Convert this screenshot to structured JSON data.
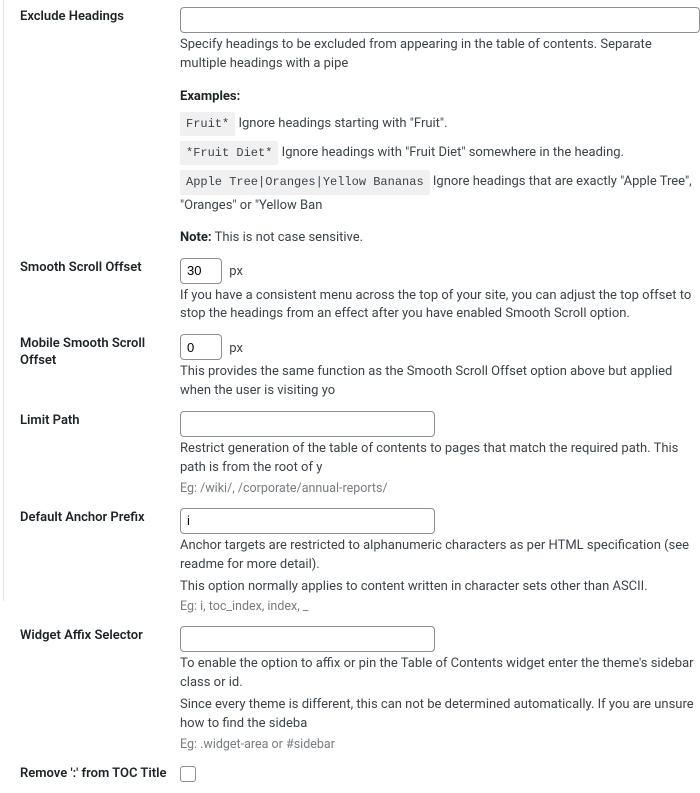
{
  "exclude": {
    "label": "Exclude Headings",
    "value": "",
    "desc": "Specify headings to be excluded from appearing in the table of contents. Separate multiple headings with a pipe",
    "examples_label": "Examples:",
    "examples": [
      {
        "code": "Fruit*",
        "text": "Ignore headings starting with \"Fruit\"."
      },
      {
        "code": "*Fruit Diet*",
        "text": "Ignore headings with \"Fruit Diet\" somewhere in the heading."
      },
      {
        "code": "Apple Tree|Oranges|Yellow Bananas",
        "text": "Ignore headings that are exactly \"Apple Tree\", \"Oranges\" or \"Yellow Ban"
      }
    ],
    "note_label": "Note:",
    "note_text": "This is not case sensitive."
  },
  "scroll": {
    "label": "Smooth Scroll Offset",
    "value": "30",
    "unit": "px",
    "desc": "If you have a consistent menu across the top of your site, you can adjust the top offset to stop the headings from an effect after you have enabled Smooth Scroll option."
  },
  "mscroll": {
    "label": "Mobile Smooth Scroll Offset",
    "value": "0",
    "unit": "px",
    "desc": "This provides the same function as the Smooth Scroll Offset option above but applied when the user is visiting yo"
  },
  "limit": {
    "label": "Limit Path",
    "value": "",
    "desc": "Restrict generation of the table of contents to pages that match the required path. This path is from the root of y",
    "eg": "Eg: /wiki/, /corporate/annual-reports/"
  },
  "anchor": {
    "label": "Default Anchor Prefix",
    "value": "i",
    "desc1": "Anchor targets are restricted to alphanumeric characters as per HTML specification (see readme for more detail).",
    "desc2": "This option normally applies to content written in character sets other than ASCII.",
    "eg": "Eg: i, toc_index, index, _"
  },
  "affix": {
    "label": "Widget Affix Selector",
    "value": "",
    "desc1": "To enable the option to affix or pin the Table of Contents widget enter the theme's sidebar class or id.",
    "desc2": "Since every theme is different, this can not be determined automatically. If you are unsure how to find the sideba",
    "eg": "Eg: .widget-area or #sidebar"
  },
  "remove_colon": {
    "label": "Remove ':' from TOC Title"
  }
}
